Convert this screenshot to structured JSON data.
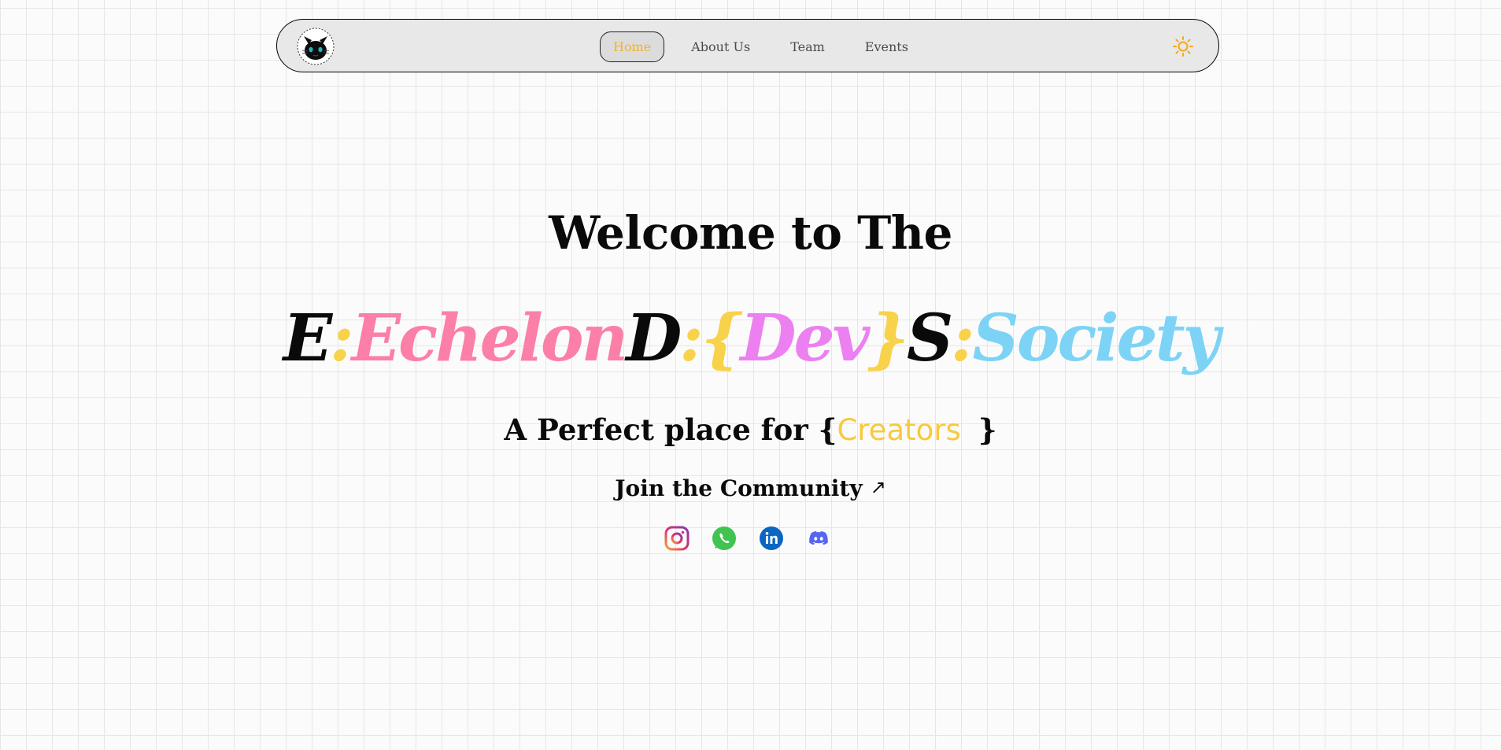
{
  "nav": {
    "logo_alt": "cat logo",
    "items": [
      {
        "label": "Home",
        "active": true
      },
      {
        "label": "About Us",
        "active": false
      },
      {
        "label": "Team",
        "active": false
      },
      {
        "label": "Events",
        "active": false
      }
    ],
    "theme_icon": "sun-icon"
  },
  "hero": {
    "welcome": "Welcome to The",
    "title": {
      "e_letter": "E",
      "e_colon": ":",
      "e_word": "Echelon",
      "d_letter": "D",
      "d_colon": ":",
      "d_open": "{",
      "d_word": "Dev",
      "d_close": "}",
      "s_letter": "S",
      "s_colon": ":",
      "s_word": "Society"
    },
    "tagline_prefix": "A Perfect place for {",
    "tagline_highlight": "Creators",
    "tagline_suffix": "}",
    "join_label": "Join the Community",
    "join_arrow": "↗"
  },
  "socials": [
    {
      "name": "instagram-icon"
    },
    {
      "name": "whatsapp-icon"
    },
    {
      "name": "linkedin-icon"
    },
    {
      "name": "discord-icon"
    }
  ],
  "colors": {
    "accent_yellow": "#f8d24a",
    "pink": "#fb7fa7",
    "purple": "#ec80f0",
    "blue": "#7dd3f5",
    "nav_active": "#f4b324"
  }
}
